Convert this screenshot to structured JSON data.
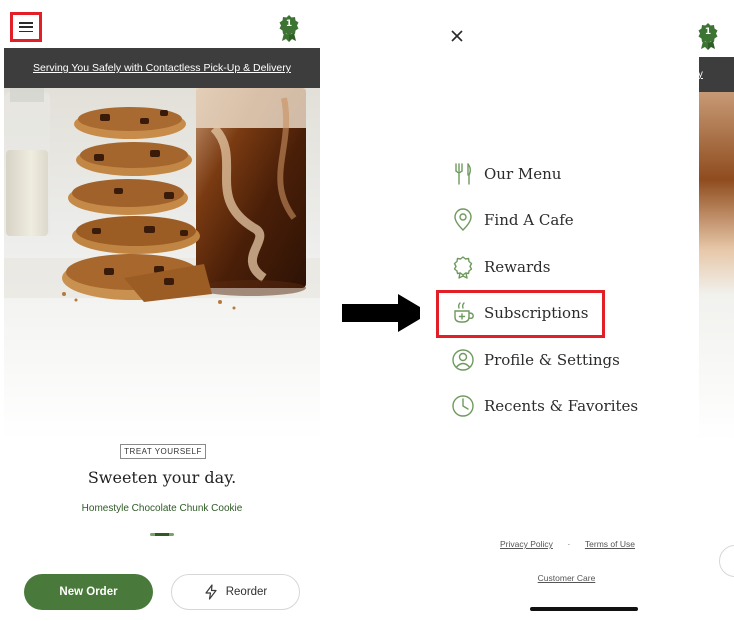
{
  "left_screen": {
    "rewards_badge_count": "1",
    "banner_text": "Serving You Safely with Contactless Pick-Up & Delivery",
    "promo_tag": "TREAT YOURSELF",
    "headline": "Sweeten your day.",
    "product_name": "Homestyle Chocolate Chunk Cookie",
    "new_order_label": "New Order",
    "reorder_label": "Reorder"
  },
  "menu_screen": {
    "items": [
      {
        "label": "Our Menu",
        "icon": "fork-knife-icon"
      },
      {
        "label": "Find A Cafe",
        "icon": "map-pin-icon"
      },
      {
        "label": "Rewards",
        "icon": "rewards-icon"
      },
      {
        "label": "Subscriptions",
        "icon": "coffee-cup-icon"
      },
      {
        "label": "Profile & Settings",
        "icon": "profile-icon"
      },
      {
        "label": "Recents & Favorites",
        "icon": "clock-icon"
      }
    ],
    "highlighted_item": "Subscriptions",
    "privacy_policy": "Privacy Policy",
    "separator": "·",
    "terms_of_use": "Terms of Use",
    "customer_care": "Customer Care"
  },
  "peek_screen": {
    "rewards_badge_count": "1",
    "banner_fragment": "ery"
  },
  "colors": {
    "brand_green": "#4a7a3b",
    "icon_green": "#6f9a5f",
    "banner_dark": "#3d3d3d",
    "highlight_red": "#e21f27"
  }
}
